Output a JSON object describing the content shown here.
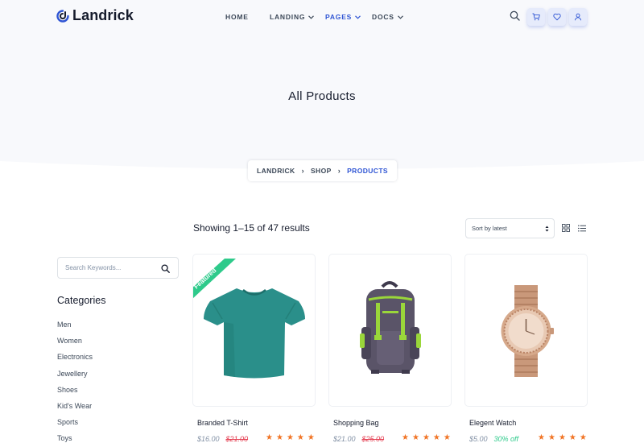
{
  "brand": {
    "name": "Landrick"
  },
  "nav": {
    "items": [
      {
        "label": "HOME",
        "dropdown": false,
        "active": false
      },
      {
        "label": "LANDING",
        "dropdown": true,
        "active": false
      },
      {
        "label": "PAGES",
        "dropdown": true,
        "active": true
      },
      {
        "label": "DOCS",
        "dropdown": true,
        "active": false
      }
    ],
    "icons": [
      "search-icon",
      "cart-icon",
      "heart-icon",
      "user-icon"
    ]
  },
  "hero": {
    "title": "All Products"
  },
  "breadcrumb": [
    {
      "label": "LANDRICK",
      "active": false
    },
    {
      "label": "SHOP",
      "active": false
    },
    {
      "label": "PRODUCTS",
      "active": true
    }
  ],
  "sidebar": {
    "search_placeholder": "Search Keywords...",
    "categories_title": "Categories",
    "categories": [
      "Men",
      "Women",
      "Electronics",
      "Jewellery",
      "Shoes",
      "Kid's Wear",
      "Sports",
      "Toys"
    ]
  },
  "toolbar": {
    "results": "Showing 1–15 of 47 results",
    "sort_selected": "Sort by latest",
    "view_icons": [
      "grid-icon",
      "list-icon"
    ]
  },
  "products": [
    {
      "name": "Branded T-Shirt",
      "price": "$16.00",
      "old_price": "$21.00",
      "off": "",
      "rating": 5,
      "badge": "Featured",
      "image": "tshirt"
    },
    {
      "name": "Shopping Bag",
      "price": "$21.00",
      "old_price": "$25.00",
      "off": "",
      "rating": 5,
      "badge": "",
      "image": "backpack"
    },
    {
      "name": "Elegent Watch",
      "price": "$5.00",
      "old_price": "",
      "off": "30% off",
      "rating": 5,
      "badge": "",
      "image": "watch"
    }
  ],
  "colors": {
    "primary": "#2f55d4",
    "heading": "#161c2d",
    "text": "#3c4858",
    "muted": "#8492a6",
    "danger": "#e43f52",
    "success": "#2eca8b",
    "star": "#f17425",
    "hero_bg": "#f8f9fc"
  }
}
